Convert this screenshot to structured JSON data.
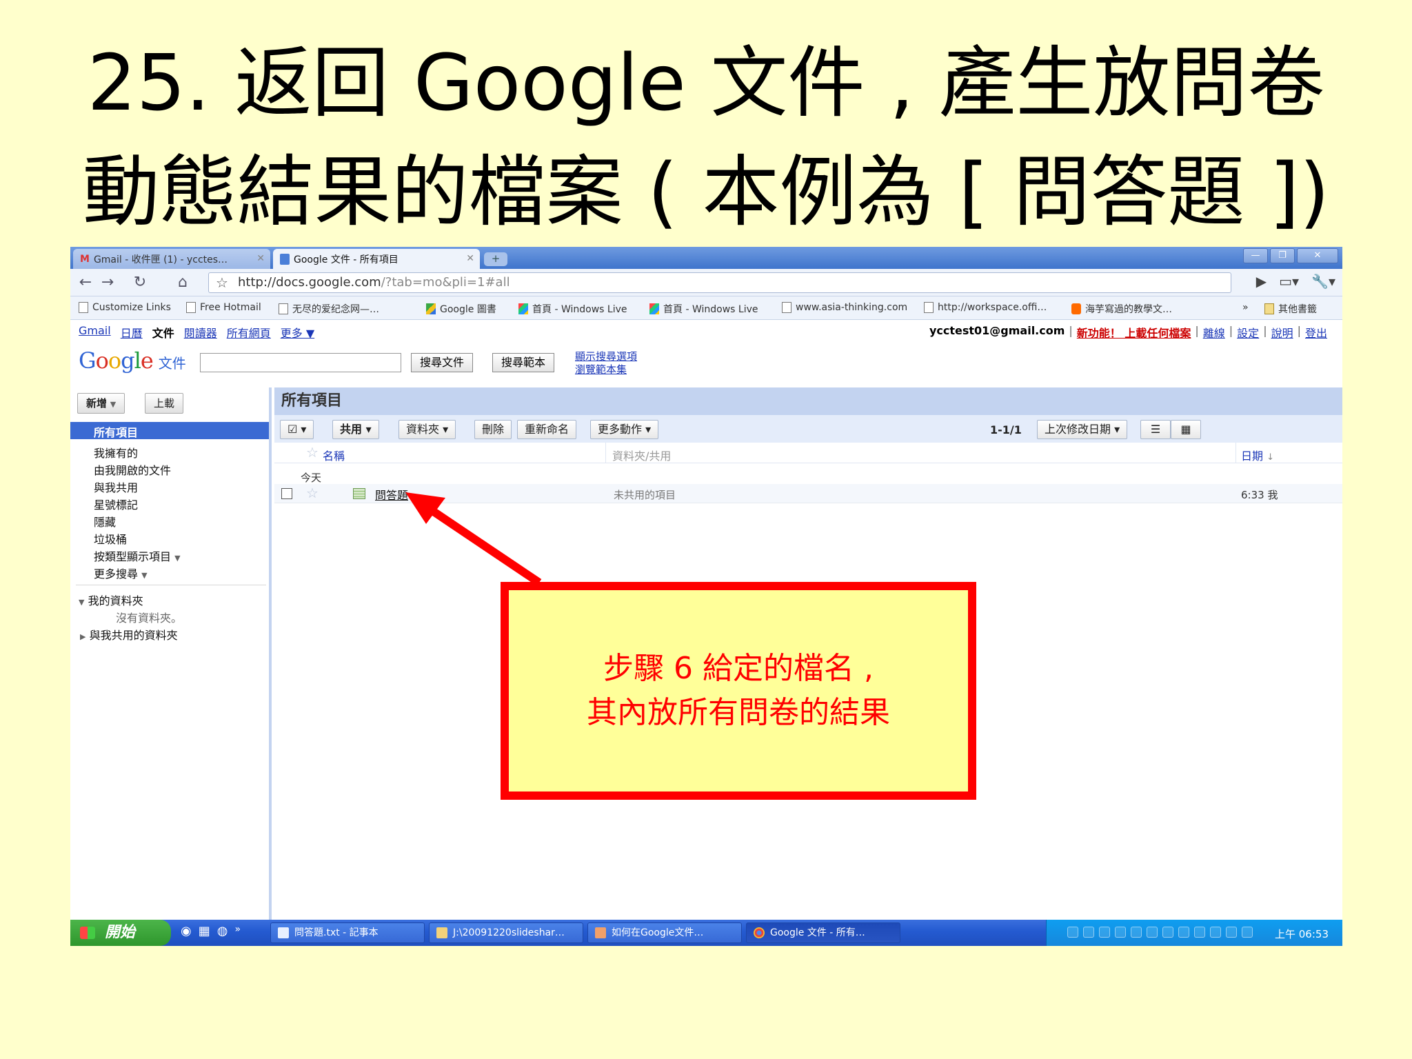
{
  "slide": {
    "title_line1": "25. 返回 Google 文件 , 產生放問卷",
    "title_line2": "動態結果的檔案 ( 本例為 [ 問答題 ])"
  },
  "browser": {
    "tabs": [
      {
        "label": "Gmail - 收件匣 (1) - ycctes…",
        "icon": "gmail-icon"
      },
      {
        "label": "Google 文件 - 所有項目",
        "icon": "docs-icon"
      }
    ],
    "url_host": "http://docs.google.com",
    "url_path": "/?tab=mo&pli=1#all",
    "bookmarks": [
      "Customize Links",
      "Free Hotmail",
      "无尽的爱纪念网—…",
      "Google 圖書",
      "首頁 - Windows Live",
      "首頁 - Windows Live",
      "www.asia-thinking.com",
      "http://workspace.offi…",
      "海芋寫過的教學文…"
    ],
    "bookmarks_overflow": "»",
    "other_bookmarks": "其他書籤"
  },
  "google_bar": {
    "links": [
      "Gmail",
      "日曆",
      "文件",
      "閱讀器",
      "所有網頁",
      "更多 ▼"
    ],
    "current": "文件",
    "email": "ycctest01@gmail.com",
    "new_feature": "新功能！ 上載任何檔案",
    "right_links": [
      "離線",
      "設定",
      "說明",
      "登出"
    ]
  },
  "docs_header": {
    "logo_suffix": "文件",
    "search_docs_btn": "搜尋文件",
    "search_templates_btn": "搜尋範本",
    "show_options_link": "顯示搜尋選項",
    "browse_templates_link": "瀏覽範本集"
  },
  "sidebar": {
    "new_btn": "新增",
    "upload_btn": "上載",
    "selected": "所有項目",
    "items": [
      "我擁有的",
      "由我開啟的文件",
      "與我共用",
      "星號標記",
      "隱藏",
      "垃圾桶",
      "按類型顯示項目",
      "更多搜尋"
    ],
    "my_folders": "我的資料夾",
    "no_folders": "沒有資料夾。",
    "shared_folders": "與我共用的資料夾"
  },
  "main": {
    "title": "所有項目",
    "actions": [
      "共用",
      "資料夾",
      "刪除",
      "重新命名",
      "更多動作"
    ],
    "page_count": "1-1/1",
    "sort": "上次修改日期",
    "columns": {
      "name": "名稱",
      "folders": "資料夾/共用",
      "date": "日期"
    },
    "group": "今天",
    "rows": [
      {
        "name": "問答題",
        "sharing": "未共用的項目",
        "date": "6:33 我"
      }
    ]
  },
  "taskbar": {
    "start": "開始",
    "tasks": [
      {
        "label": "問答題.txt - 記事本",
        "active": false
      },
      {
        "label": "J:\\20091220slideshar…",
        "active": false
      },
      {
        "label": "如何在Google文件…",
        "active": false
      },
      {
        "label": "Google 文件 - 所有…",
        "active": true
      }
    ],
    "clock": "上午 06:53"
  },
  "callout": {
    "line1": "步驟 6 給定的檔名 ,",
    "line2": "其內放所有問卷的結果",
    "color": "#ff0000",
    "fill": "#ffff99"
  }
}
